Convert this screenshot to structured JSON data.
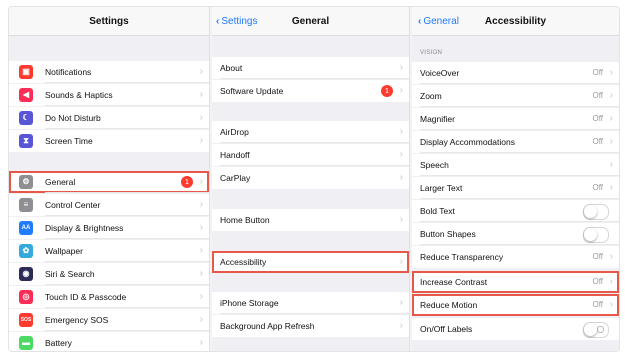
{
  "settings": {
    "title": "Settings",
    "items": [
      {
        "label": "Notifications",
        "icon": "notifications-icon",
        "color": "#ff3b30",
        "glyph": "▣"
      },
      {
        "label": "Sounds & Haptics",
        "icon": "sound-icon",
        "color": "#ff2d55",
        "glyph": "◀"
      },
      {
        "label": "Do Not Disturb",
        "icon": "moon-icon",
        "color": "#5856d6",
        "glyph": "☾"
      },
      {
        "label": "Screen Time",
        "icon": "hourglass-icon",
        "color": "#5856d6",
        "glyph": "⧗"
      },
      {
        "label": "General",
        "icon": "gear-icon",
        "color": "#8e8e93",
        "glyph": "⚙",
        "badge": "1"
      },
      {
        "label": "Control Center",
        "icon": "switches-icon",
        "color": "#8e8e93",
        "glyph": "≡"
      },
      {
        "label": "Display & Brightness",
        "icon": "display-icon",
        "color": "#1f7bff",
        "glyph": "AA"
      },
      {
        "label": "Wallpaper",
        "icon": "flower-icon",
        "color": "#34aadc",
        "glyph": "✿"
      },
      {
        "label": "Siri & Search",
        "icon": "siri-icon",
        "color": "#2c2c54",
        "glyph": "◉"
      },
      {
        "label": "Touch ID & Passcode",
        "icon": "fingerprint-icon",
        "color": "#ff2d55",
        "glyph": "◎"
      },
      {
        "label": "Emergency SOS",
        "icon": "sos-icon",
        "color": "#ff3b30",
        "glyph": "SOS"
      },
      {
        "label": "Battery",
        "icon": "battery-icon",
        "color": "#4cd964",
        "glyph": "▬"
      }
    ]
  },
  "general": {
    "back": "Settings",
    "title": "General",
    "items": [
      {
        "label": "About"
      },
      {
        "label": "Software Update",
        "badge": "1"
      },
      {
        "label": "AirDrop"
      },
      {
        "label": "Handoff"
      },
      {
        "label": "CarPlay"
      },
      {
        "label": "Home Button"
      },
      {
        "label": "Accessibility"
      },
      {
        "label": "iPhone Storage"
      },
      {
        "label": "Background App Refresh"
      }
    ]
  },
  "accessibility": {
    "back": "General",
    "title": "Accessibility",
    "section": "VISION",
    "items": [
      {
        "label": "VoiceOver",
        "value": "Off"
      },
      {
        "label": "Zoom",
        "value": "Off"
      },
      {
        "label": "Magnifier",
        "value": "Off"
      },
      {
        "label": "Display Accommodations",
        "value": "Off"
      },
      {
        "label": "Speech"
      },
      {
        "label": "Larger Text",
        "value": "Off"
      },
      {
        "label": "Bold Text"
      },
      {
        "label": "Button Shapes"
      },
      {
        "label": "Reduce Transparency",
        "value": "Off"
      },
      {
        "label": "Increase Contrast",
        "value": "Off"
      },
      {
        "label": "Reduce Motion",
        "value": "Off"
      },
      {
        "label": "On/Off Labels"
      }
    ]
  },
  "chevron": "›",
  "highlight_color": "#e8584a"
}
